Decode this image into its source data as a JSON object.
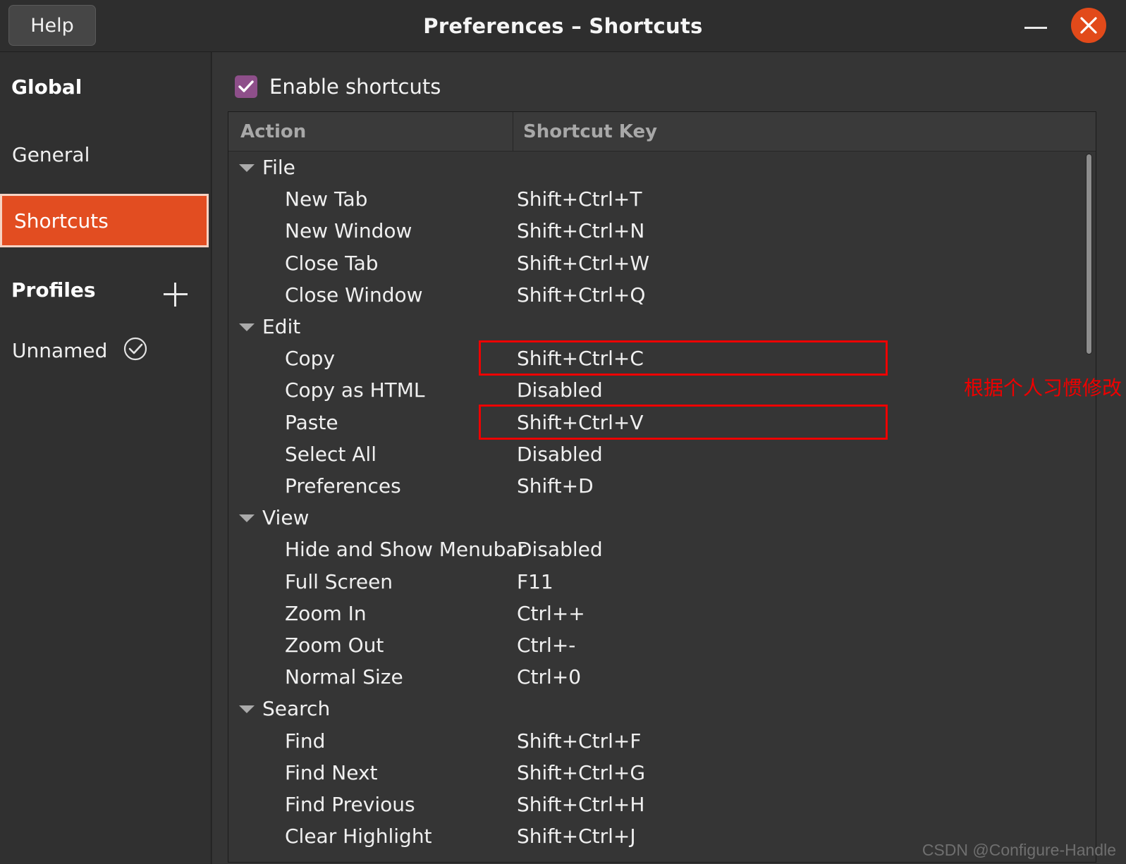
{
  "window": {
    "title": "Preferences – Shortcuts",
    "help_label": "Help",
    "minimize_label": "–",
    "close_label": "✕",
    "accent_color": "#e24a1a",
    "background_color": "#353535"
  },
  "sidebar": {
    "global_header": "Global",
    "items": [
      {
        "label": "General",
        "selected": false
      },
      {
        "label": "Shortcuts",
        "selected": true
      }
    ],
    "profiles_header": "Profiles",
    "add_profile_icon": "plus-icon",
    "profiles": [
      {
        "label": "Unnamed",
        "icon": "check-circle-icon"
      }
    ]
  },
  "main": {
    "enable_shortcuts": {
      "label": "Enable shortcuts",
      "checked": true,
      "checkbox_color": "#8e4f8a"
    },
    "table": {
      "columns": [
        "Action",
        "Shortcut Key"
      ],
      "groups": [
        {
          "name": "File",
          "expanded": true,
          "rows": [
            {
              "action": "New Tab",
              "key": "Shift+Ctrl+T"
            },
            {
              "action": "New Window",
              "key": "Shift+Ctrl+N"
            },
            {
              "action": "Close Tab",
              "key": "Shift+Ctrl+W"
            },
            {
              "action": "Close Window",
              "key": "Shift+Ctrl+Q"
            }
          ]
        },
        {
          "name": "Edit",
          "expanded": true,
          "rows": [
            {
              "action": "Copy",
              "key": "Shift+Ctrl+C",
              "highlighted": true
            },
            {
              "action": "Copy as HTML",
              "key": "Disabled"
            },
            {
              "action": "Paste",
              "key": "Shift+Ctrl+V",
              "highlighted": true
            },
            {
              "action": "Select All",
              "key": "Disabled"
            },
            {
              "action": "Preferences",
              "key": "Shift+D"
            }
          ]
        },
        {
          "name": "View",
          "expanded": true,
          "rows": [
            {
              "action": "Hide and Show Menubar",
              "key": "Disabled"
            },
            {
              "action": "Full Screen",
              "key": "F11"
            },
            {
              "action": "Zoom In",
              "key": "Ctrl++"
            },
            {
              "action": "Zoom Out",
              "key": "Ctrl+-"
            },
            {
              "action": "Normal Size",
              "key": "Ctrl+0"
            }
          ]
        },
        {
          "name": "Search",
          "expanded": true,
          "rows": [
            {
              "action": "Find",
              "key": "Shift+Ctrl+F"
            },
            {
              "action": "Find Next",
              "key": "Shift+Ctrl+G"
            },
            {
              "action": "Find Previous",
              "key": "Shift+Ctrl+H"
            },
            {
              "action": "Clear Highlight",
              "key": "Shift+Ctrl+J"
            }
          ]
        }
      ]
    },
    "annotation": {
      "text": "根据个人习惯修改",
      "color": "#ee0000"
    }
  },
  "watermark": "CSDN @Configure-Handle"
}
